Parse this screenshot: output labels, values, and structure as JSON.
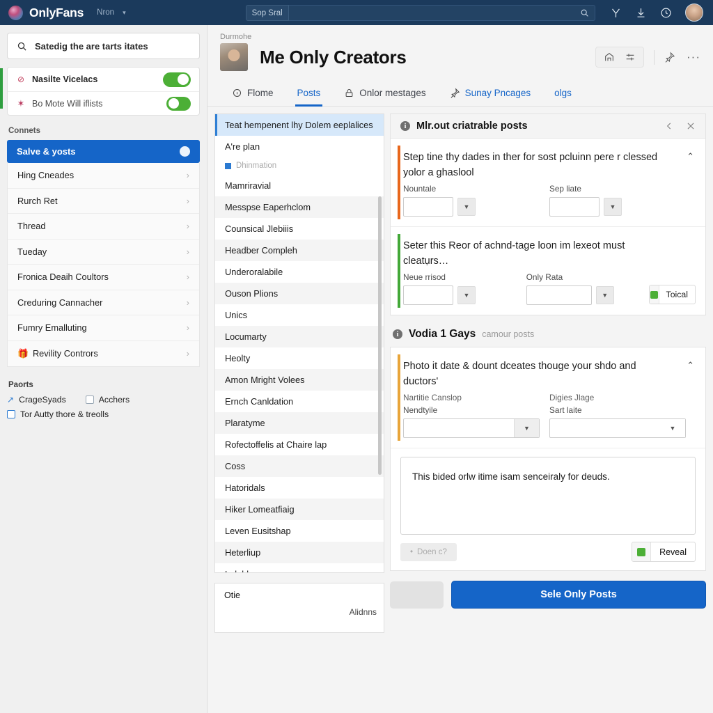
{
  "topbar": {
    "brand": "OnlyFans",
    "brand_sub": "Nron",
    "caret": "▾",
    "search_chip": "Sop Sral",
    "search_placeholder": "",
    "icons": [
      "branch-icon",
      "download-icon",
      "clock-icon",
      "avatar"
    ]
  },
  "sidebar": {
    "search_text": "Satedig the are tarts itates",
    "toggles": [
      {
        "icon": "ban-icon",
        "label": "Nasilte Vicelacs",
        "state": "on"
      },
      {
        "icon": "asterisk-icon",
        "label": "Bo Mote Will iflists",
        "state": "off"
      }
    ],
    "group_title": "Connets",
    "selected_item": "Salve & yosts",
    "items": [
      {
        "label": "Hing Cneades",
        "icon": ""
      },
      {
        "label": "Rurch Ret",
        "icon": ""
      },
      {
        "label": "Thread",
        "icon": ""
      },
      {
        "label": "Tueday",
        "icon": ""
      },
      {
        "label": "Fronica Deaih Coultors",
        "icon": ""
      },
      {
        "label": "Creduring Cannacher",
        "icon": ""
      },
      {
        "label": "Fumry Emalluting",
        "icon": ""
      },
      {
        "label": "Revility Contrors",
        "icon": "gift-icon"
      }
    ],
    "paorts_title": "Paorts",
    "checks": [
      {
        "label": "CrageSyads",
        "kind": "link"
      },
      {
        "label": "Acchers",
        "kind": "checkbox"
      },
      {
        "label": "Tor Autty thore & treolls",
        "kind": "checkbox-blue"
      }
    ]
  },
  "main": {
    "breadcrumb": "Durmohe",
    "title": "Me Only Creators",
    "tools": [
      "home-icon",
      "sliders-icon",
      "pin-icon",
      "more-icon"
    ],
    "tabs": [
      {
        "label": "Flome",
        "icon": "info-circle-icon",
        "active": false
      },
      {
        "label": "Posts",
        "icon": "",
        "active": true
      },
      {
        "label": "Onlor mestages",
        "icon": "lock-icon",
        "active": false
      },
      {
        "label": "Sunay Pncages",
        "icon": "pin-icon",
        "active": false,
        "blue": true
      },
      {
        "label": "olgs",
        "icon": "",
        "active": false,
        "blue": true
      }
    ]
  },
  "listpane": {
    "selected": "Teat hempenent lhy Dolem eeplalices",
    "second": "A're plan",
    "group_label": "Dhinmation",
    "items": [
      "Mamriravial",
      "Messpse Eaperhclom",
      "Counsical Jlebiiis",
      "Headber Compleh",
      "Underoralabile",
      "Ouson Plions",
      "Unics",
      "Locumarty",
      "Heolty",
      "Amon Mright Volees",
      "Ernch Canldation",
      "Plaratyme",
      "Rofectoffelis at Chaire lap",
      "Coss",
      "Hatoridals",
      "Hiker Lomeatfiaig",
      "Leven Eusitshap",
      "Heterliup",
      "Lalobloa"
    ],
    "footer_title": "Otie",
    "footer_mid": "Alidnns"
  },
  "right": {
    "card1": {
      "title": "Mlr.out criatrable posts",
      "nav_prev": "‹",
      "expand_icon": "expand-icon",
      "sections": [
        {
          "accent": "orange",
          "title": "Step tine thy dades in ther for sost pcluinn pere r clessed yolor a ghaslool",
          "caret": "⌃",
          "fields": [
            {
              "label": "Nountale",
              "value": ""
            },
            {
              "label": "Sep liate",
              "value": ""
            }
          ],
          "action": null
        },
        {
          "accent": "green",
          "title": "Seter this Reor of achnd-tage loon im lexeot must cleatụrs…",
          "caret": "",
          "fields": [
            {
              "label": "Neue rrisod",
              "value": ""
            },
            {
              "label": "Only Rata",
              "value": ""
            }
          ],
          "action": "Toical"
        }
      ]
    },
    "card2": {
      "title": "Vodia 1 Gays",
      "subtitle": "camour posts",
      "section": {
        "accent": "amber",
        "title": "Photo it date & dount dceates thouge your shdo and ductors'",
        "caret": "⌃",
        "sublabels": [
          "Nartitie Canslop",
          "Digies Jlage"
        ],
        "fields": [
          {
            "label": "Nendtyile",
            "value": ""
          },
          {
            "label": "Sart laite",
            "value": ""
          }
        ]
      },
      "textarea_value": "This bided orlw itime isam senceiraly for deuds.",
      "ghost_button": "Doen c?",
      "reveal_button": "Reveal"
    }
  },
  "actionbar": {
    "primary_label": "Sele Only Posts"
  }
}
